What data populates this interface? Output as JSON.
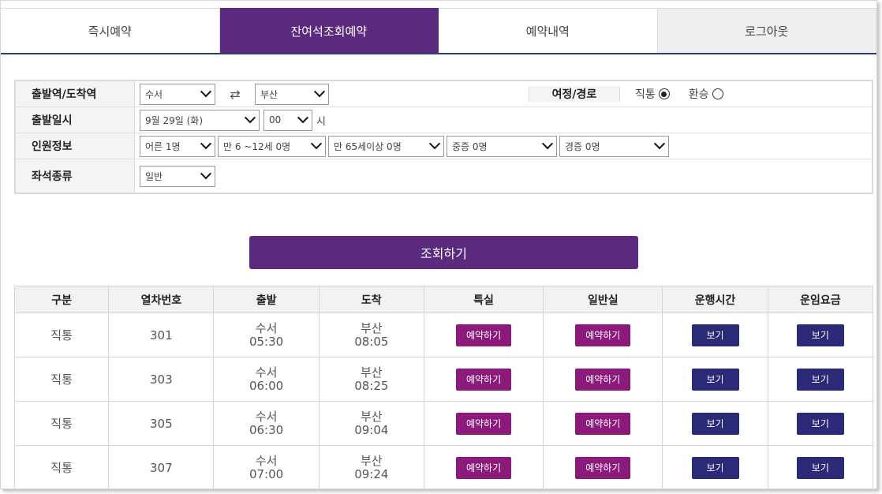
{
  "tabs": [
    {
      "label": "즉시예약"
    },
    {
      "label": "잔여석조회예약"
    },
    {
      "label": "예약내역"
    },
    {
      "label": "로그아웃"
    }
  ],
  "form": {
    "station_label": "출발역/도착역",
    "departure_station": "수서",
    "arrival_station": "부산",
    "swap_icon": "⇄",
    "route_label": "여정/경로",
    "route_direct": "직통",
    "route_transfer": "환승",
    "date_label": "출발일시",
    "date_value": "9월 29일 (화)",
    "hour_value": "00",
    "hour_unit": "시",
    "passenger_label": "인원정보",
    "adult": "어른 1명",
    "child": "만 6 ~12세 0명",
    "senior": "만 65세이상 0명",
    "severe_disabled": "중증 0명",
    "mild_disabled": "경증 0명",
    "seat_label": "좌석종류",
    "seat_value": "일반"
  },
  "search_button": "조회하기",
  "table": {
    "headers": [
      "구분",
      "열차번호",
      "출발",
      "도착",
      "특실",
      "일반실",
      "운행시간",
      "운임요금"
    ],
    "reserve_label": "예약하기",
    "view_label": "보기",
    "rows": [
      {
        "type": "직통",
        "train": "301",
        "dep_station": "수서",
        "dep_time": "05:30",
        "arr_station": "부산",
        "arr_time": "08:05"
      },
      {
        "type": "직통",
        "train": "303",
        "dep_station": "수서",
        "dep_time": "06:00",
        "arr_station": "부산",
        "arr_time": "08:25"
      },
      {
        "type": "직통",
        "train": "305",
        "dep_station": "수서",
        "dep_time": "06:30",
        "arr_station": "부산",
        "arr_time": "09:04"
      },
      {
        "type": "직통",
        "train": "307",
        "dep_station": "수서",
        "dep_time": "07:00",
        "arr_station": "부산",
        "arr_time": "09:24"
      }
    ]
  }
}
